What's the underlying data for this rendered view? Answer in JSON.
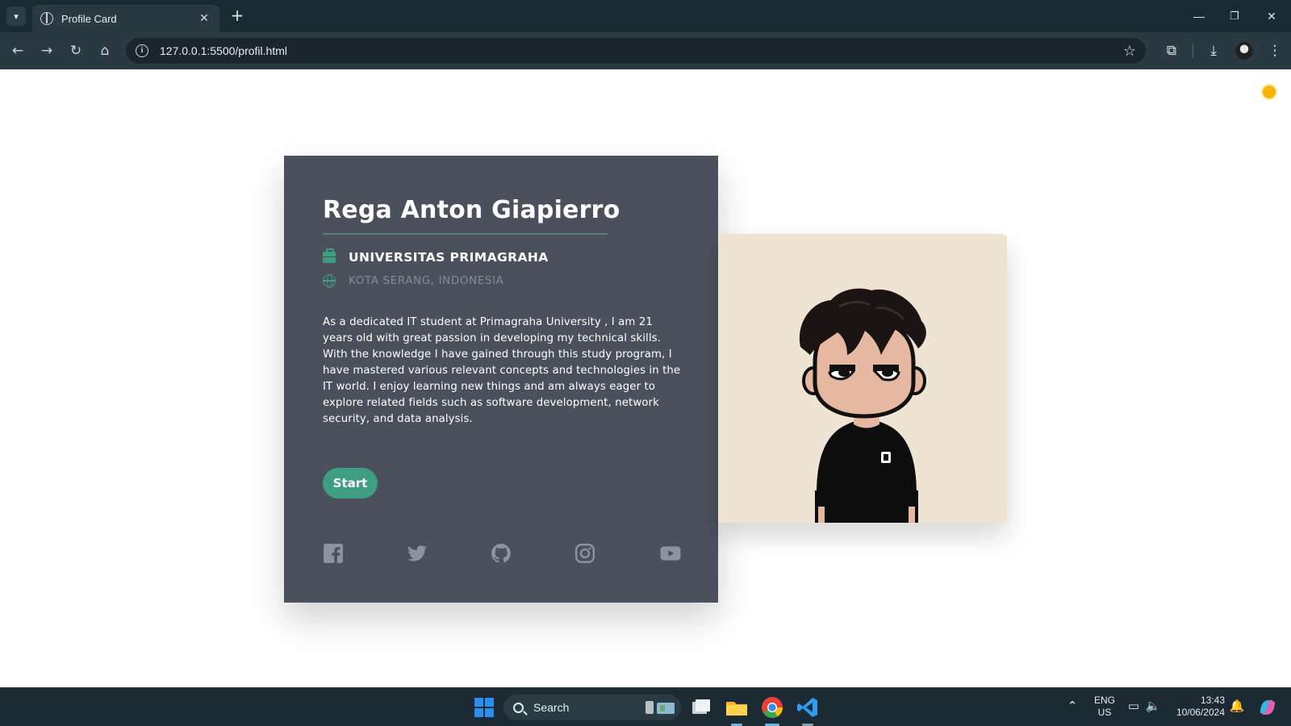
{
  "browser": {
    "tab_title": "Profile Card",
    "tab_close": "✕",
    "new_tab": "+",
    "url": "127.0.0.1:5500/profil.html",
    "window_controls": {
      "minimize": "—",
      "restore": "❐",
      "close": "✕"
    }
  },
  "profile": {
    "name": "Rega Anton Giapierro",
    "university": "UNIVERSITAS PRIMAGRAHA",
    "location": "KOTA SERANG, INDONESIA",
    "bio": "As a dedicated IT student at Primagraha University , I am 21 years old with great passion in developing my technical skills. With the knowledge I have gained through this study program, I have mastered various relevant concepts and technologies in the IT world. I enjoy learning new things and am always eager to explore related fields such as software development, network security, and data analysis.",
    "start_label": "Start",
    "socials": [
      "facebook-icon",
      "twitter-icon",
      "github-icon",
      "instagram-icon",
      "youtube-icon"
    ]
  },
  "colors": {
    "card_bg": "#4a505c",
    "accent": "#3d9e82",
    "photo_bg": "#efe3d3",
    "muted": "#838b96",
    "social_icon": "#8d949e"
  },
  "taskbar": {
    "search_placeholder": "Search",
    "language": "ENG",
    "region": "US",
    "time": "13:43",
    "date": "10/06/2024"
  }
}
